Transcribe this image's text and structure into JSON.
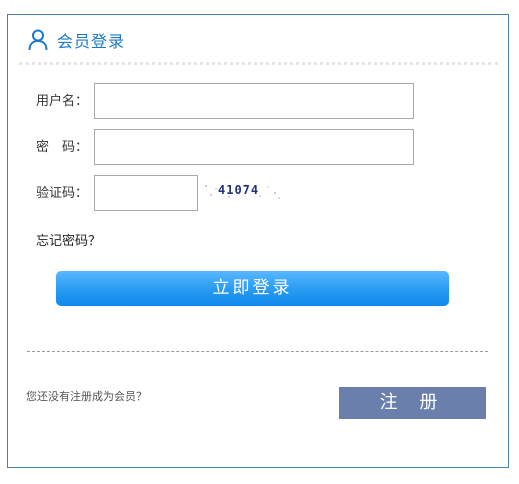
{
  "header": {
    "title": "会员登录",
    "icon": "user-icon"
  },
  "form": {
    "username_label": "用户名：",
    "username_value": "",
    "password_label": "密　码：",
    "password_value": "",
    "captcha_label": "验证码：",
    "captcha_value": "",
    "captcha_text": "41074"
  },
  "forgot_password": "忘记密码？",
  "login_button": "立即登录",
  "register": {
    "prompt": "您还没有注册成为会员？",
    "button": "注 册"
  },
  "colors": {
    "accent": "#1b78c6",
    "login_button": "#1a90ee",
    "register_button": "#6b7fad",
    "border": "#4a7da8"
  }
}
